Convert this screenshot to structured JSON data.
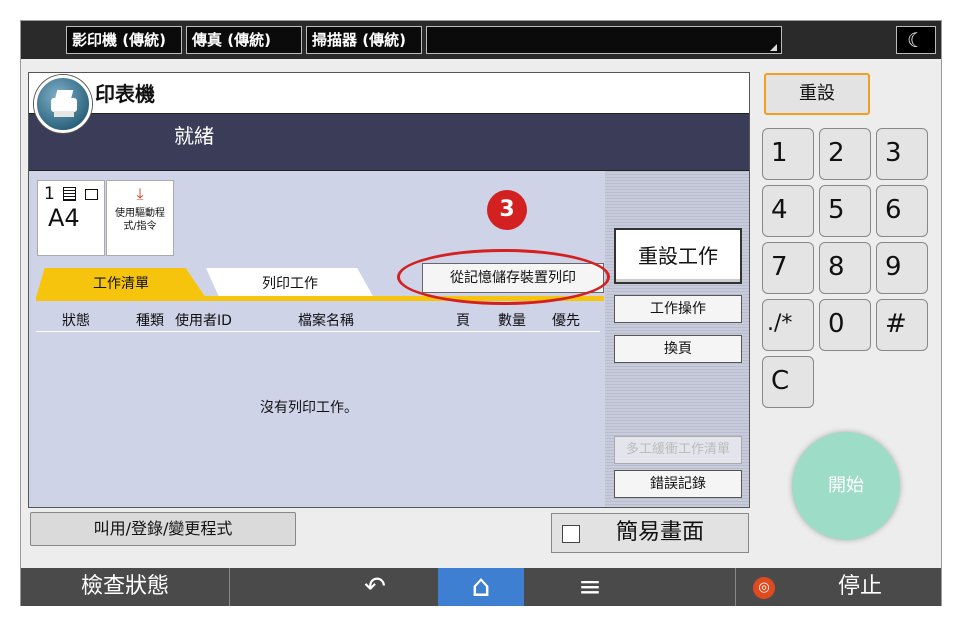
{
  "top_tabs": [
    "影印機 (傳統)",
    "傳真 (傳統)",
    "掃描器 (傳統)"
  ],
  "top_tab_empty": "",
  "moon_glyph": "☾",
  "app": {
    "title": "印表機",
    "status": "就緒"
  },
  "info": {
    "count": "1",
    "paper_size": "A4",
    "driver_label": "使用驅動程式/指令"
  },
  "step_number": "3",
  "tabs": [
    "工作清單",
    "列印工作"
  ],
  "usb_print_button": "從記憶儲存裝置列印",
  "table": {
    "headers": [
      "狀態",
      "種類",
      "使用者ID",
      "檔案名稱",
      "頁",
      "數量",
      "優先"
    ],
    "empty_message": "沒有列印工作。"
  },
  "side_buttons": {
    "reset_job": "重設工作",
    "job_operation": "工作操作",
    "change_page": "換頁",
    "multi_buffer_list": "多工緩衝工作清單",
    "error_log": "錯誤記錄"
  },
  "bottom_buttons": {
    "call_program": "叫用/登錄/變更程式",
    "simple_screen": "簡易畫面"
  },
  "keypad": {
    "reset": "重設",
    "keys": [
      "1",
      "2",
      "3",
      "4",
      "5",
      "6",
      "7",
      "8",
      "9",
      "./*",
      "0",
      "#",
      "C"
    ],
    "start": "開始"
  },
  "bottom_bar": {
    "check_status": "檢查狀態",
    "back_glyph": "↶",
    "home_glyph": "⌂",
    "menu_glyph": "≡",
    "stop": "停止"
  },
  "colors": {
    "accent_tab": "#f6c40d",
    "annotation": "#d32020",
    "start_button": "#9ddcc6",
    "home_button": "#3f7fd1"
  }
}
